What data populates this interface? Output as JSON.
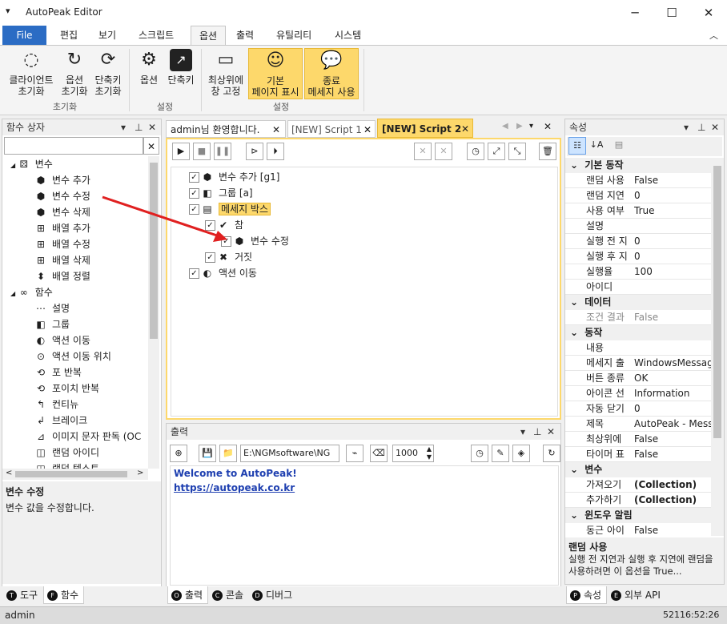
{
  "app": {
    "title": "AutoPeak Editor"
  },
  "menu_tabs": [
    "File",
    "편집",
    "보기",
    "스크립트",
    "옵션",
    "출력",
    "유틸리티",
    "시스템"
  ],
  "ribbon": {
    "buttons": [
      {
        "label1": "클라이언트",
        "label2": "초기화",
        "icon": "refresh-dashed-icon"
      },
      {
        "label1": "옵션",
        "label2": "초기화",
        "icon": "refresh-icon"
      },
      {
        "label1": "단축키",
        "label2": "초기화",
        "icon": "refresh-arrows-icon"
      },
      {
        "label1": "옵션",
        "label2": "",
        "icon": "gear-icon"
      },
      {
        "label1": "단축키",
        "label2": "",
        "icon": "shortcut-icon"
      },
      {
        "label1": "최상위에",
        "label2": "창 고정",
        "icon": "window-pin-icon"
      },
      {
        "label1": "기본",
        "label2": "페이지 표시",
        "icon": "smiley-icon"
      },
      {
        "label1": "종료",
        "label2": "메세지 사용",
        "icon": "chat-bubble-icon"
      }
    ],
    "groups": [
      "초기화",
      "설정",
      "설정"
    ]
  },
  "func_panel": {
    "title": "함수 상자",
    "items": [
      {
        "label": "변수",
        "level": 0,
        "group": true
      },
      {
        "label": "변수 추가",
        "level": 1
      },
      {
        "label": "변수 수정",
        "level": 1
      },
      {
        "label": "변수 삭제",
        "level": 1
      },
      {
        "label": "배열 추가",
        "level": 1
      },
      {
        "label": "배열 수정",
        "level": 1
      },
      {
        "label": "배열 삭제",
        "level": 1
      },
      {
        "label": "배열 정렬",
        "level": 1
      },
      {
        "label": "함수",
        "level": 0,
        "group": true
      },
      {
        "label": "설명",
        "level": 1
      },
      {
        "label": "그룹",
        "level": 1
      },
      {
        "label": "액션 이동",
        "level": 1
      },
      {
        "label": "액션 이동 위치",
        "level": 1
      },
      {
        "label": "포 반복",
        "level": 1
      },
      {
        "label": "포이치 반복",
        "level": 1
      },
      {
        "label": "컨티뉴",
        "level": 1
      },
      {
        "label": "브레이크",
        "level": 1
      },
      {
        "label": "이미지 문자 판독 (OC",
        "level": 1
      },
      {
        "label": "랜덤 아이디",
        "level": 1
      },
      {
        "label": "랜덤 텍스트",
        "level": 1
      }
    ],
    "desc_title": "변수 수정",
    "desc_text": "변수 값을 수정합니다.",
    "bottom_tabs": [
      "도구",
      "함수"
    ]
  },
  "doc_tabs": [
    "admin님 환영합니다.",
    "[NEW] Script 1",
    "[NEW] Script 2"
  ],
  "script_tree": [
    {
      "label": "변수 추가 [g1]",
      "level": 0
    },
    {
      "label": "그룹 [a]",
      "level": 0
    },
    {
      "label": "메세지 박스",
      "level": 0,
      "selected": true
    },
    {
      "label": "참",
      "level": 1
    },
    {
      "label": "변수 수정",
      "level": 2
    },
    {
      "label": "거짓",
      "level": 1
    },
    {
      "label": "액션 이동",
      "level": 0
    }
  ],
  "output": {
    "title": "출력",
    "path": "E:\\NGMsoftware\\NG",
    "number": "1000",
    "welcome": "Welcome to AutoPeak!",
    "link": "https://autopeak.co.kr",
    "bottom_tabs": [
      "출력",
      "콘솔",
      "디버그"
    ]
  },
  "props": {
    "title": "속성",
    "rows": [
      {
        "cat": "기본 동작"
      },
      {
        "name": "랜덤 사용",
        "value": "False"
      },
      {
        "name": "랜덤 지연",
        "value": "0"
      },
      {
        "name": "사용 여부",
        "value": "True"
      },
      {
        "name": "설명",
        "value": ""
      },
      {
        "name": "실행 전 지",
        "value": "0"
      },
      {
        "name": "실행 후 지",
        "value": "0"
      },
      {
        "name": "실행율",
        "value": "100"
      },
      {
        "name": "아이디",
        "value": ""
      },
      {
        "cat": "데이터"
      },
      {
        "name": "조건 결과",
        "value": "False",
        "gray": true
      },
      {
        "cat": "동작"
      },
      {
        "name": "내용",
        "value": ""
      },
      {
        "name": "메세지 출",
        "value": "WindowsMessage"
      },
      {
        "name": "버튼 종류",
        "value": "OK"
      },
      {
        "name": "아이콘 선",
        "value": "Information"
      },
      {
        "name": "자동 닫기",
        "value": "0"
      },
      {
        "name": "제목",
        "value": "AutoPeak - Messa"
      },
      {
        "name": "최상위에",
        "value": "False"
      },
      {
        "name": "타이머 표",
        "value": "False"
      },
      {
        "cat": "변수"
      },
      {
        "name": "가져오기",
        "value": "(Collection)",
        "bold": true
      },
      {
        "name": "추가하기",
        "value": "(Collection)",
        "bold": true
      },
      {
        "cat": "윈도우 알림"
      },
      {
        "name": "동근 아이",
        "value": "False"
      }
    ],
    "desc_title": "랜덤 사용",
    "desc_text": "실행 전 지연과 실행 후 지연에 랜덤을 사용하려면 이 옵션을 True...",
    "bottom_tabs": [
      "속성",
      "외부 API"
    ]
  },
  "status": {
    "user": "admin",
    "time": "52116:52:26"
  }
}
